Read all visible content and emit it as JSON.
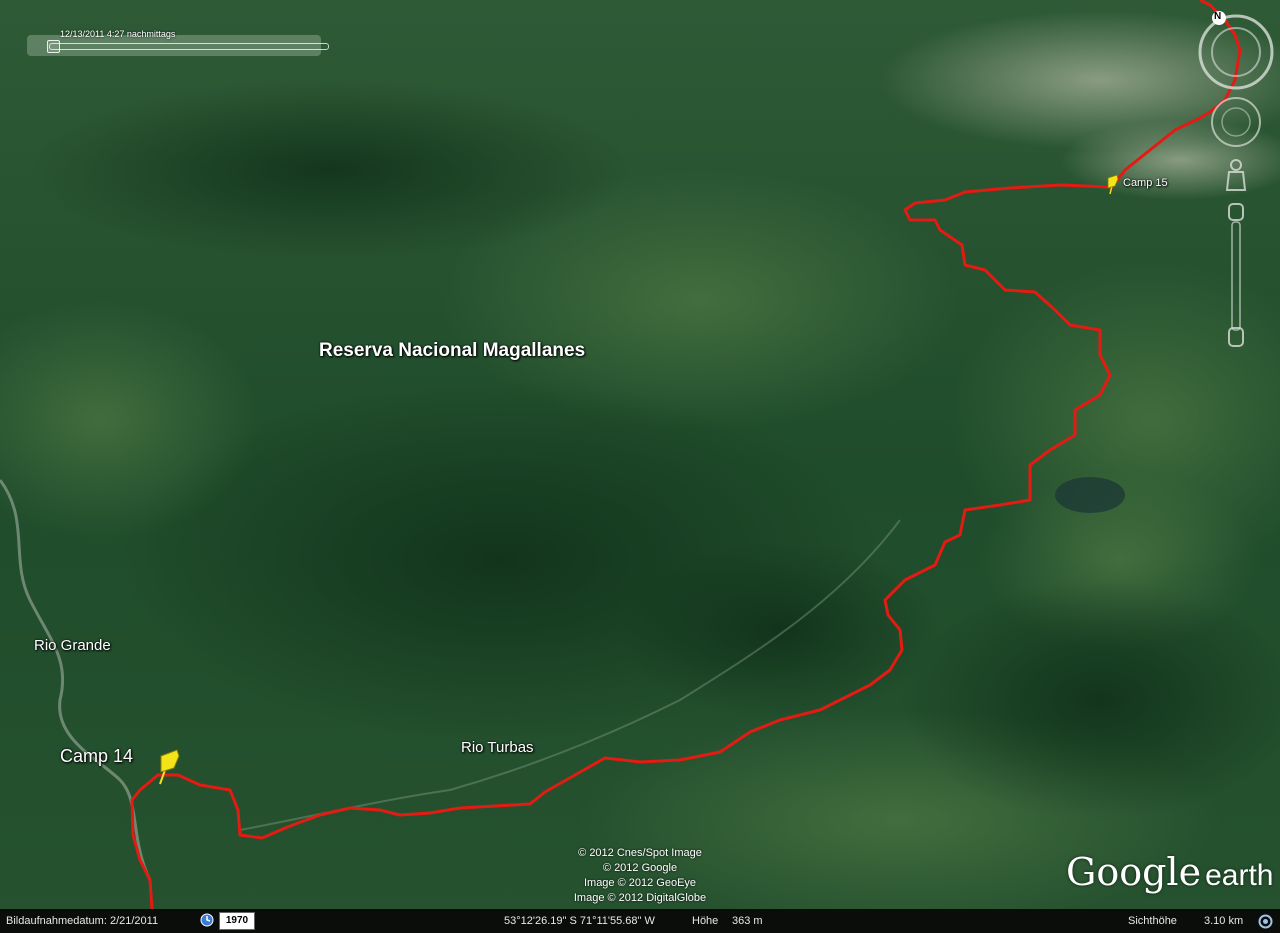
{
  "time_slider": {
    "label": "12/13/2011   4:27 nachmittags"
  },
  "map": {
    "region_label": "Reserva Nacional Magallanes",
    "labels": {
      "rio_grande": "Rio Grande",
      "rio_turbas": "Rio Turbas"
    },
    "placemarks": [
      {
        "name": "Camp 14"
      },
      {
        "name": "Camp 15"
      }
    ],
    "route_color": "#e31b12",
    "placemark_color": "#f2e31a"
  },
  "attribution": [
    "© 2012 Cnes/Spot Image",
    "© 2012 Google",
    "Image © 2012 GeoEye",
    "Image © 2012 DigitalGlobe"
  ],
  "logo": {
    "brand": "Google",
    "product": "earth"
  },
  "navigation": {
    "compass_letter": "N",
    "icons": [
      "compass-ring-icon",
      "look-joystick-icon",
      "street-view-pegman-icon",
      "zoom-slider-icon"
    ]
  },
  "status_bar": {
    "imagery_date": "Bildaufnahmedatum: 2/21/2011",
    "historical_year": "1970",
    "coordinates": "53°12'26.19\" S  71°11'55.68\" W",
    "elevation_label": "Höhe",
    "elevation": "363 m",
    "eye_alt_label": "Sichthöhe",
    "eye_alt": "3.10 km"
  }
}
